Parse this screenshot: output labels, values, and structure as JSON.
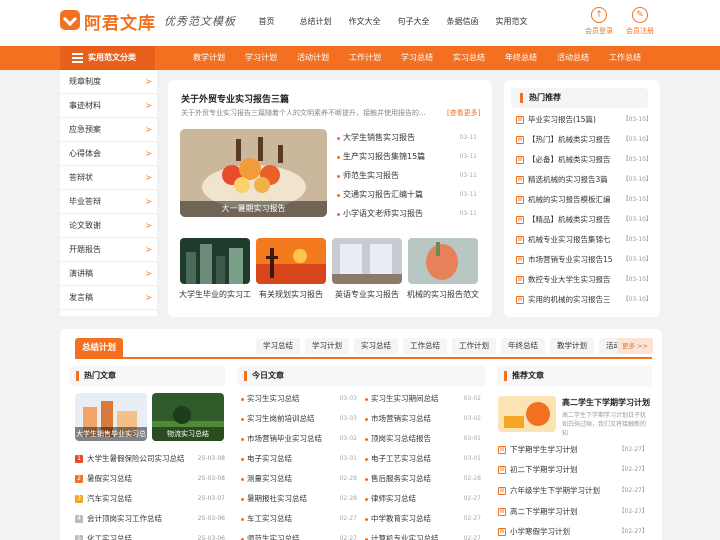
{
  "header": {
    "logo_text": "阿君文库",
    "slogan": "优秀范文模板",
    "nav": [
      "首页",
      "总结计划",
      "作文大全",
      "句子大全",
      "条据信函",
      "实用范文"
    ],
    "login": "会员登录",
    "register": "会员注册"
  },
  "catbar": {
    "label": "实用范文分类",
    "items": [
      "教学计划",
      "学习计划",
      "活动计划",
      "工作计划",
      "学习总结",
      "实习总结",
      "年终总结",
      "活动总结",
      "工作总结"
    ]
  },
  "sidebar": {
    "items": [
      "规章制度",
      "事迹材料",
      "应急预案",
      "心得体会",
      "答辩状",
      "毕业答辩",
      "论文致谢",
      "开题报告",
      "演讲稿",
      "发言稿"
    ],
    "arrow": ">"
  },
  "featured": {
    "title": "关于外贸专业实习报告三篇",
    "desc": "关于外贸专业实习报告三篇随着个人的文明素养不断提升，接触并使用报告的...",
    "more": "[查看更多]",
    "big_caption": "大一暑期实习报告",
    "list": [
      {
        "title": "大学生销售实习报告",
        "date": "03-11"
      },
      {
        "title": "生产实习报告集锦15篇",
        "date": "03-11"
      },
      {
        "title": "师范生实习报告",
        "date": "03-11"
      },
      {
        "title": "交通实习报告汇编十篇",
        "date": "03-11"
      },
      {
        "title": "小学语文老师实习报告",
        "date": "03-11"
      }
    ],
    "thumbs": [
      "大学生毕业的实习工",
      "有关规划实习报告",
      "英语专业实习报告",
      "机械的实习报告范文"
    ]
  },
  "hot": {
    "title": "热门推荐",
    "items": [
      {
        "title": "毕业实习报告(15篇)",
        "date": "【03-10】"
      },
      {
        "title": "【热门】机械类实习报告",
        "date": "【03-10】"
      },
      {
        "title": "【必备】机械类实习报告",
        "date": "【03-10】"
      },
      {
        "title": "精选机械的实习报告3篇",
        "date": "【03-10】"
      },
      {
        "title": "机械的实习报告模板汇编",
        "date": "【03-10】"
      },
      {
        "title": "【精品】机械类实习报告",
        "date": "【03-10】"
      },
      {
        "title": "机械专业实习报告集锦七",
        "date": "【03-10】"
      },
      {
        "title": "市场营销专业实习报告15",
        "date": "【03-10】"
      },
      {
        "title": "数控专业大学生实习报告",
        "date": "【03-10】"
      },
      {
        "title": "实用的机械的实习报告三",
        "date": "【03-10】"
      }
    ]
  },
  "section": {
    "title": "总结计划",
    "tags": [
      "学习总结",
      "学习计划",
      "实习总结",
      "工作总结",
      "工作计划",
      "年终总结",
      "教学计划",
      "活动总结"
    ],
    "more": "更多 >>",
    "hot_articles": {
      "title": "热门文章",
      "img_captions": [
        "大学生销售毕业实习总",
        "物流实习总结"
      ],
      "items": [
        {
          "n": "1",
          "title": "大学生暑假保险公司实习总结",
          "date": "25-03-08"
        },
        {
          "n": "2",
          "title": "暑假实习总结",
          "date": "25-03-08"
        },
        {
          "n": "3",
          "title": "汽车实习总结",
          "date": "25-03-07"
        },
        {
          "n": "4",
          "title": "会计顶岗实习工作总结",
          "date": "25-03-06"
        },
        {
          "n": "5",
          "title": "化工实习总结",
          "date": "25-03-06"
        }
      ]
    },
    "today": {
      "title": "今日文章",
      "left": [
        {
          "title": "实习生实习总结",
          "date": "03-03"
        },
        {
          "title": "实习生岗前培训总结",
          "date": "03-03"
        },
        {
          "title": "市场营销毕业实习总结",
          "date": "03-02"
        },
        {
          "title": "电子实习总结",
          "date": "03-01"
        },
        {
          "title": "测量实习总结",
          "date": "02-28"
        },
        {
          "title": "暑期报社实习总结",
          "date": "02-28"
        },
        {
          "title": "车工实习总结",
          "date": "02-27"
        },
        {
          "title": "师范生实习总结",
          "date": "02-27"
        }
      ],
      "right": [
        {
          "title": "实习生实习期间总结",
          "date": "03-02"
        },
        {
          "title": "市场营销实习总结",
          "date": "03-02"
        },
        {
          "title": "顶岗实习总结报告",
          "date": "03-01"
        },
        {
          "title": "电子工艺实习总结",
          "date": "03-01"
        },
        {
          "title": "售后服务实习总结",
          "date": "02-28"
        },
        {
          "title": "律师实习总结",
          "date": "02-27"
        },
        {
          "title": "中学教育实习总结",
          "date": "02-27"
        },
        {
          "title": "计算机专业实习总结",
          "date": "02-27"
        }
      ]
    },
    "recommend": {
      "title": "推荐文章",
      "card_title": "高二学生下学期学习计划",
      "card_desc": "高二学生下学期学习计划日子犹如白驹过隙，我们又将接触新的知",
      "items": [
        {
          "title": "下学期学生学习计划",
          "date": "【02-27】"
        },
        {
          "title": "初二下学期学习计划",
          "date": "【02-27】"
        },
        {
          "title": "六年级学生下学期学习计划",
          "date": "【02-27】"
        },
        {
          "title": "高二下学期学习计划",
          "date": "【02-27】"
        },
        {
          "title": "小学寒假学习计划",
          "date": "【02-27】"
        }
      ]
    }
  },
  "colors": {
    "accent": "#f37021",
    "accent_dark": "#e8601a"
  },
  "icons": [
    "logo-check-icon",
    "menu-icon",
    "login-icon",
    "register-icon",
    "doc-icon",
    "chevron-right-icon"
  ]
}
